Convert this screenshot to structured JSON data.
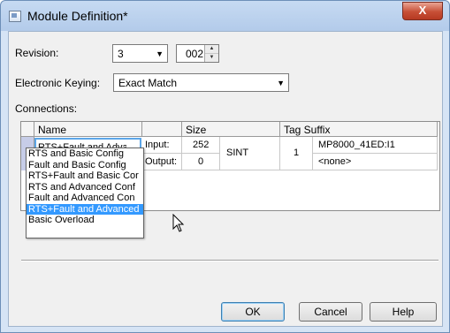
{
  "window": {
    "title": "Module Definition*",
    "close_label": "X"
  },
  "revision": {
    "label": "Revision:",
    "major": "3",
    "minor": "002"
  },
  "keying": {
    "label": "Electronic Keying:",
    "value": "Exact Match"
  },
  "connections": {
    "label": "Connections:",
    "headers": {
      "name": "Name",
      "size": "Size",
      "tag_suffix": "Tag Suffix"
    },
    "selected_name": "RTS+Fault and Advai",
    "rows": [
      {
        "io": "Input:",
        "size": "252",
        "tag": "MP8000_41ED:I1"
      },
      {
        "io": "Output:",
        "size": "0",
        "tag": "<none>"
      }
    ],
    "data_type": "SINT",
    "count": "1"
  },
  "dropdown": {
    "options": [
      "RTS and Basic Config",
      "Fault and Basic Config",
      "RTS+Fault and Basic Cor",
      "RTS and Advanced Conf",
      "Fault and Advanced Con",
      "RTS+Fault and Advanced",
      "Basic Overload"
    ],
    "selected_index": 5
  },
  "buttons": {
    "ok": "OK",
    "cancel": "Cancel",
    "help": "Help"
  }
}
